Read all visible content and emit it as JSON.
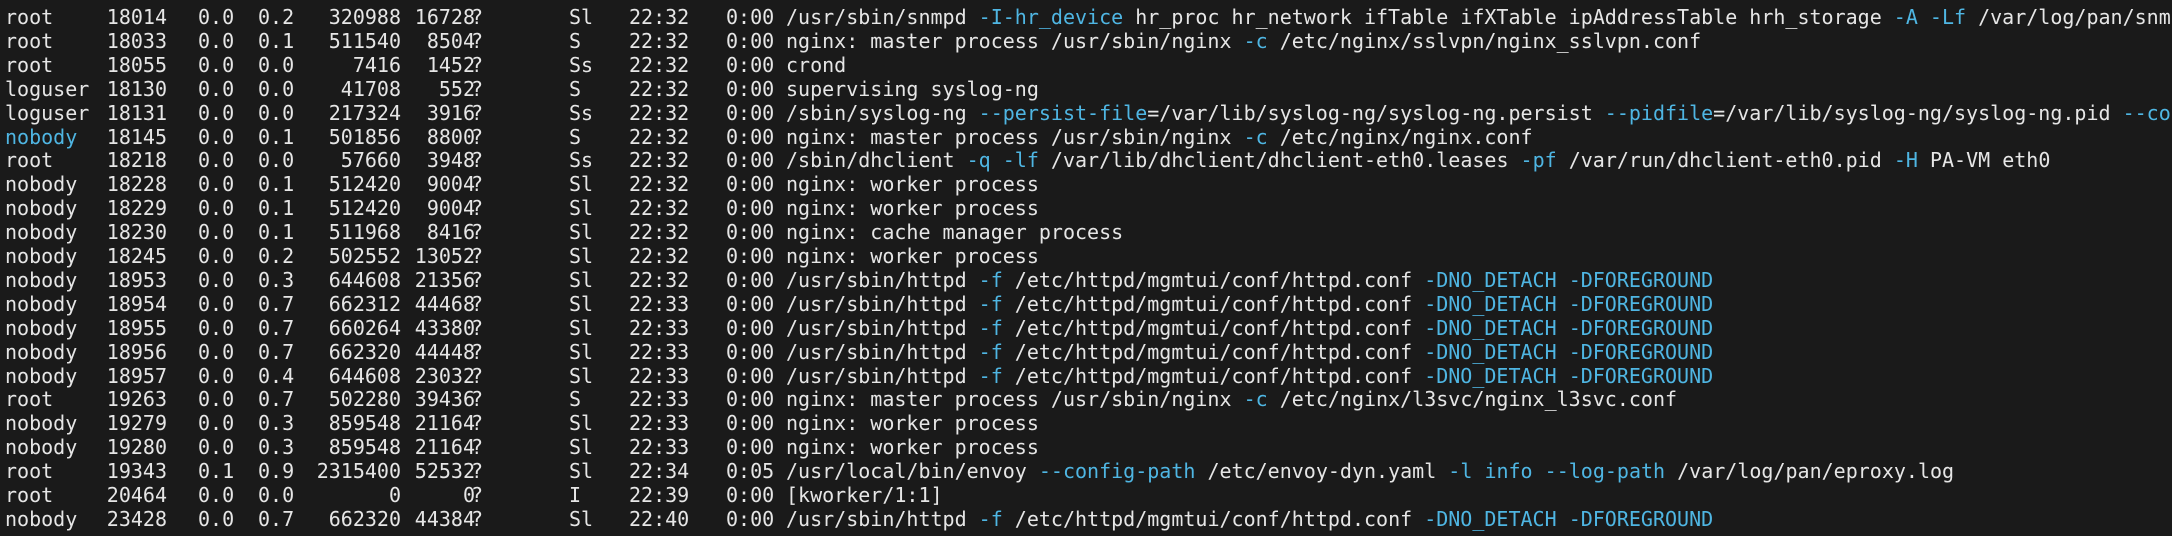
{
  "colors": {
    "background": "#1a1a1a",
    "text": "#e6e6e6",
    "highlight": "#4fb6e3"
  },
  "rows": [
    {
      "user": "root",
      "pid": "18014",
      "cpu": "0.0",
      "mem": "0.2",
      "vsz": "320988",
      "rss": "16728",
      "tty": "?",
      "stat": "Sl",
      "start": "22:32",
      "time": "0:00",
      "cmd": [
        {
          "t": "/usr/sbin/snmpd "
        },
        {
          "t": "-I-hr_device",
          "h": true
        },
        {
          "t": " hr_proc hr_network ifTable ifXTable ipAddressTable hrh_storage "
        },
        {
          "t": "-A",
          "h": true
        },
        {
          "t": " "
        },
        {
          "t": "-Lf",
          "h": true
        },
        {
          "t": " /var/log/pan/snm"
        }
      ]
    },
    {
      "user": "root",
      "pid": "18033",
      "cpu": "0.0",
      "mem": "0.1",
      "vsz": "511540",
      "rss": "8504",
      "tty": "?",
      "stat": "S",
      "start": "22:32",
      "time": "0:00",
      "cmd": [
        {
          "t": "nginx: master process /usr/sbin/nginx "
        },
        {
          "t": "-c",
          "h": true
        },
        {
          "t": " /etc/nginx/sslvpn/nginx_sslvpn.conf"
        }
      ]
    },
    {
      "user": "root",
      "pid": "18055",
      "cpu": "0.0",
      "mem": "0.0",
      "vsz": "7416",
      "rss": "1452",
      "tty": "?",
      "stat": "Ss",
      "start": "22:32",
      "time": "0:00",
      "cmd": [
        {
          "t": "crond"
        }
      ]
    },
    {
      "user": "loguser",
      "pid": "18130",
      "cpu": "0.0",
      "mem": "0.0",
      "vsz": "41708",
      "rss": "552",
      "tty": "?",
      "stat": "S",
      "start": "22:32",
      "time": "0:00",
      "cmd": [
        {
          "t": "supervising syslog-ng"
        }
      ]
    },
    {
      "user": "loguser",
      "pid": "18131",
      "cpu": "0.0",
      "mem": "0.0",
      "vsz": "217324",
      "rss": "3916",
      "tty": "?",
      "stat": "Ss",
      "start": "22:32",
      "time": "0:00",
      "cmd": [
        {
          "t": "/sbin/syslog-ng "
        },
        {
          "t": "--persist-file",
          "h": true
        },
        {
          "t": "=/var/lib/syslog-ng/syslog-ng.persist "
        },
        {
          "t": "--pidfile",
          "h": true
        },
        {
          "t": "=/var/lib/syslog-ng/syslog-ng.pid "
        },
        {
          "t": "--co",
          "h": true
        }
      ]
    },
    {
      "user": "nobody",
      "userBlue": true,
      "pid": "18145",
      "cpu": "0.0",
      "mem": "0.1",
      "vsz": "501856",
      "rss": "8800",
      "tty": "?",
      "stat": "S",
      "start": "22:32",
      "time": "0:00",
      "cmd": [
        {
          "t": "nginx: master process /usr/sbin/nginx "
        },
        {
          "t": "-c",
          "h": true
        },
        {
          "t": " /etc/nginx/nginx.conf"
        }
      ]
    },
    {
      "user": "root",
      "pid": "18218",
      "cpu": "0.0",
      "mem": "0.0",
      "vsz": "57660",
      "rss": "3948",
      "tty": "?",
      "stat": "Ss",
      "start": "22:32",
      "time": "0:00",
      "cmd": [
        {
          "t": "/sbin/dhclient "
        },
        {
          "t": "-q",
          "h": true
        },
        {
          "t": " "
        },
        {
          "t": "-lf",
          "h": true
        },
        {
          "t": " /var/lib/dhclient/dhclient-eth0.leases "
        },
        {
          "t": "-pf",
          "h": true
        },
        {
          "t": " /var/run/dhclient-eth0.pid "
        },
        {
          "t": "-H",
          "h": true
        },
        {
          "t": " PA-VM eth0"
        }
      ]
    },
    {
      "user": "nobody",
      "pid": "18228",
      "cpu": "0.0",
      "mem": "0.1",
      "vsz": "512420",
      "rss": "9004",
      "tty": "?",
      "stat": "Sl",
      "start": "22:32",
      "time": "0:00",
      "cmd": [
        {
          "t": "nginx: worker process"
        }
      ]
    },
    {
      "user": "nobody",
      "pid": "18229",
      "cpu": "0.0",
      "mem": "0.1",
      "vsz": "512420",
      "rss": "9004",
      "tty": "?",
      "stat": "Sl",
      "start": "22:32",
      "time": "0:00",
      "cmd": [
        {
          "t": "nginx: worker process"
        }
      ]
    },
    {
      "user": "nobody",
      "pid": "18230",
      "cpu": "0.0",
      "mem": "0.1",
      "vsz": "511968",
      "rss": "8416",
      "tty": "?",
      "stat": "Sl",
      "start": "22:32",
      "time": "0:00",
      "cmd": [
        {
          "t": "nginx: cache manager process"
        }
      ]
    },
    {
      "user": "nobody",
      "pid": "18245",
      "cpu": "0.0",
      "mem": "0.2",
      "vsz": "502552",
      "rss": "13052",
      "tty": "?",
      "stat": "Sl",
      "start": "22:32",
      "time": "0:00",
      "cmd": [
        {
          "t": "nginx: worker process"
        }
      ]
    },
    {
      "user": "nobody",
      "pid": "18953",
      "cpu": "0.0",
      "mem": "0.3",
      "vsz": "644608",
      "rss": "21356",
      "tty": "?",
      "stat": "Sl",
      "start": "22:32",
      "time": "0:00",
      "cmd": [
        {
          "t": "/usr/sbin/httpd "
        },
        {
          "t": "-f",
          "h": true
        },
        {
          "t": " /etc/httpd/mgmtui/conf/httpd.conf "
        },
        {
          "t": "-DNO_DETACH",
          "h": true
        },
        {
          "t": " "
        },
        {
          "t": "-DFOREGROUND",
          "h": true
        }
      ]
    },
    {
      "user": "nobody",
      "pid": "18954",
      "cpu": "0.0",
      "mem": "0.7",
      "vsz": "662312",
      "rss": "44468",
      "tty": "?",
      "stat": "Sl",
      "start": "22:33",
      "time": "0:00",
      "cmd": [
        {
          "t": "/usr/sbin/httpd "
        },
        {
          "t": "-f",
          "h": true
        },
        {
          "t": " /etc/httpd/mgmtui/conf/httpd.conf "
        },
        {
          "t": "-DNO_DETACH",
          "h": true
        },
        {
          "t": " "
        },
        {
          "t": "-DFOREGROUND",
          "h": true
        }
      ]
    },
    {
      "user": "nobody",
      "pid": "18955",
      "cpu": "0.0",
      "mem": "0.7",
      "vsz": "660264",
      "rss": "43380",
      "tty": "?",
      "stat": "Sl",
      "start": "22:33",
      "time": "0:00",
      "cmd": [
        {
          "t": "/usr/sbin/httpd "
        },
        {
          "t": "-f",
          "h": true
        },
        {
          "t": " /etc/httpd/mgmtui/conf/httpd.conf "
        },
        {
          "t": "-DNO_DETACH",
          "h": true
        },
        {
          "t": " "
        },
        {
          "t": "-DFOREGROUND",
          "h": true
        }
      ]
    },
    {
      "user": "nobody",
      "pid": "18956",
      "cpu": "0.0",
      "mem": "0.7",
      "vsz": "662320",
      "rss": "44448",
      "tty": "?",
      "stat": "Sl",
      "start": "22:33",
      "time": "0:00",
      "cmd": [
        {
          "t": "/usr/sbin/httpd "
        },
        {
          "t": "-f",
          "h": true
        },
        {
          "t": " /etc/httpd/mgmtui/conf/httpd.conf "
        },
        {
          "t": "-DNO_DETACH",
          "h": true
        },
        {
          "t": " "
        },
        {
          "t": "-DFOREGROUND",
          "h": true
        }
      ]
    },
    {
      "user": "nobody",
      "pid": "18957",
      "cpu": "0.0",
      "mem": "0.4",
      "vsz": "644608",
      "rss": "23032",
      "tty": "?",
      "stat": "Sl",
      "start": "22:33",
      "time": "0:00",
      "cmd": [
        {
          "t": "/usr/sbin/httpd "
        },
        {
          "t": "-f",
          "h": true
        },
        {
          "t": " /etc/httpd/mgmtui/conf/httpd.conf "
        },
        {
          "t": "-DNO_DETACH",
          "h": true
        },
        {
          "t": " "
        },
        {
          "t": "-DFOREGROUND",
          "h": true
        }
      ]
    },
    {
      "user": "root",
      "pid": "19263",
      "cpu": "0.0",
      "mem": "0.7",
      "vsz": "502280",
      "rss": "39436",
      "tty": "?",
      "stat": "S",
      "start": "22:33",
      "time": "0:00",
      "cmd": [
        {
          "t": "nginx: master process /usr/sbin/nginx "
        },
        {
          "t": "-c",
          "h": true
        },
        {
          "t": " /etc/nginx/l3svc/nginx_l3svc.conf"
        }
      ]
    },
    {
      "user": "nobody",
      "pid": "19279",
      "cpu": "0.0",
      "mem": "0.3",
      "vsz": "859548",
      "rss": "21164",
      "tty": "?",
      "stat": "Sl",
      "start": "22:33",
      "time": "0:00",
      "cmd": [
        {
          "t": "nginx: worker process"
        }
      ]
    },
    {
      "user": "nobody",
      "pid": "19280",
      "cpu": "0.0",
      "mem": "0.3",
      "vsz": "859548",
      "rss": "21164",
      "tty": "?",
      "stat": "Sl",
      "start": "22:33",
      "time": "0:00",
      "cmd": [
        {
          "t": "nginx: worker process"
        }
      ]
    },
    {
      "user": "root",
      "pid": "19343",
      "cpu": "0.1",
      "mem": "0.9",
      "vsz": "2315400",
      "rss": "52532",
      "tty": "?",
      "stat": "Sl",
      "start": "22:34",
      "time": "0:05",
      "cmd": [
        {
          "t": "/usr/local/bin/envoy "
        },
        {
          "t": "--config-path",
          "h": true
        },
        {
          "t": " /etc/envoy-dyn.yaml "
        },
        {
          "t": "-l",
          "h": true
        },
        {
          "t": " "
        },
        {
          "t": "info",
          "h": true
        },
        {
          "t": " "
        },
        {
          "t": "--log-path",
          "h": true
        },
        {
          "t": " /var/log/pan/eproxy.log"
        }
      ]
    },
    {
      "user": "root",
      "pid": "20464",
      "cpu": "0.0",
      "mem": "0.0",
      "vsz": "0",
      "rss": "0",
      "tty": "?",
      "stat": "I",
      "start": "22:39",
      "time": "0:00",
      "cmd": [
        {
          "t": "[kworker/1:1]"
        }
      ]
    },
    {
      "user": "nobody",
      "pid": "23428",
      "cpu": "0.0",
      "mem": "0.7",
      "vsz": "662320",
      "rss": "44384",
      "tty": "?",
      "stat": "Sl",
      "start": "22:40",
      "time": "0:00",
      "cmd": [
        {
          "t": "/usr/sbin/httpd "
        },
        {
          "t": "-f",
          "h": true
        },
        {
          "t": " /etc/httpd/mgmtui/conf/httpd.conf "
        },
        {
          "t": "-DNO_DETACH",
          "h": true
        },
        {
          "t": " "
        },
        {
          "t": "-DFOREGROUND",
          "h": true
        }
      ]
    }
  ]
}
